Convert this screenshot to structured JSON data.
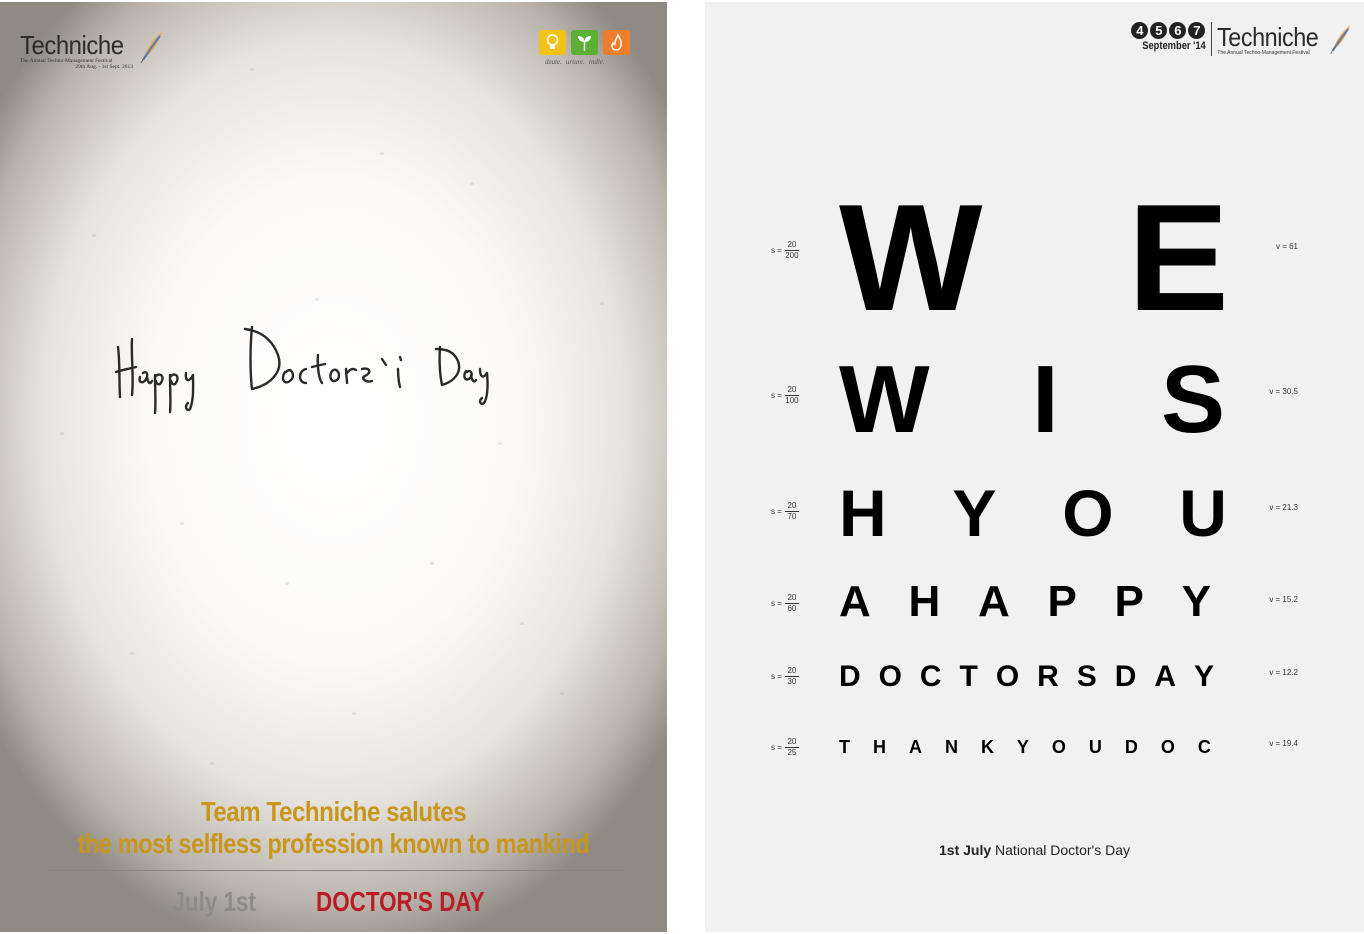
{
  "left_poster": {
    "brand": {
      "wordmark": "Techniche",
      "tagline": "The Annual Techno-Management Festival",
      "dates": "29th Aug. - 1st Sept. 2013",
      "logo_icon": "quill-feather-icon"
    },
    "tiles": {
      "icons": [
        "lightbulb-icon",
        "sprout-icon",
        "flame-icon"
      ],
      "captions": [
        "deate.",
        "urture.",
        "indle."
      ],
      "colors": [
        "#f2c316",
        "#5cb135",
        "#ef7e2a"
      ]
    },
    "handwritten": "Happy Doctors' Day",
    "salute_line1": "Team Techniche salutes",
    "salute_line2": "the most selfless profession known to mankind",
    "date_text": "July 1st",
    "day_text": "DOCTOR'S DAY",
    "colors": {
      "salute": "#c8961a",
      "date": "#8e8b88",
      "day": "#b81d24"
    }
  },
  "right_poster": {
    "brand": {
      "circle_digits": [
        "4",
        "5",
        "6",
        "7"
      ],
      "month": "September '14",
      "wordmark": "Techniche",
      "tagline": "The Annual Techno-Management Festival",
      "logo_icon": "quill-feather-icon"
    },
    "chart_rows": [
      {
        "s_prefix": "s =",
        "s_num": "20",
        "s_den": "200",
        "letters": [
          "W",
          "E"
        ],
        "v": "v = 61"
      },
      {
        "s_prefix": "s =",
        "s_num": "20",
        "s_den": "100",
        "letters": [
          "W",
          "I",
          "S"
        ],
        "v": "v = 30.5"
      },
      {
        "s_prefix": "s =",
        "s_num": "20",
        "s_den": "70",
        "letters": [
          "H",
          "Y",
          "O",
          "U"
        ],
        "v": "v = 21.3"
      },
      {
        "s_prefix": "s =",
        "s_num": "20",
        "s_den": "60",
        "letters": [
          "A",
          "H",
          "A",
          "P",
          "P",
          "Y"
        ],
        "v": "v = 15.2"
      },
      {
        "s_prefix": "s =",
        "s_num": "20",
        "s_den": "30",
        "letters": [
          "D",
          "O",
          "C",
          "T",
          "O",
          "R",
          "S",
          "D",
          "A",
          "Y"
        ],
        "v": "v = 12.2"
      },
      {
        "s_prefix": "s =",
        "s_num": "20",
        "s_den": "25",
        "letters": [
          "T",
          "H",
          "A",
          "N",
          "K",
          "Y",
          "O",
          "U",
          "D",
          "O",
          "C"
        ],
        "v": "v = 19.4"
      }
    ],
    "footer_bold": "1st July",
    "footer_rest": " National Doctor's Day"
  }
}
